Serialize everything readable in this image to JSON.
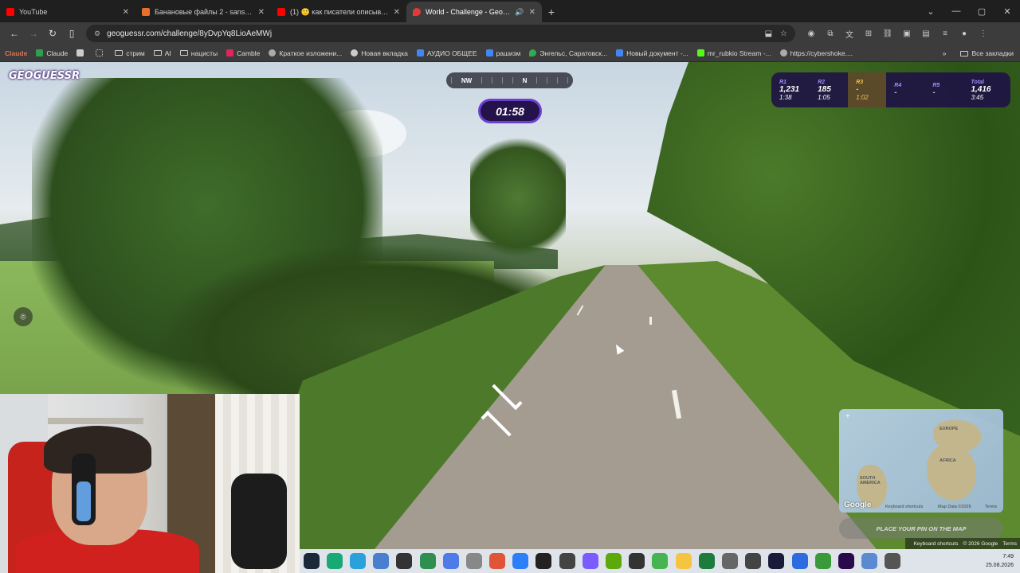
{
  "tabs": [
    {
      "title": "YouTube",
      "favicon_color": "#ff0000",
      "active": false
    },
    {
      "title": "Банановые файлы 2 - sansgot...",
      "favicon_color": "#e8702a",
      "active": false
    },
    {
      "title": "(1) 🙂 как писатели описывают...",
      "favicon_color": "#ff0000",
      "active": false
    },
    {
      "title": "World - Challenge - GeoGu...",
      "favicon_color": "#e03a3a",
      "active": true
    }
  ],
  "address_bar": {
    "url": "geoguessr.com/challenge/8yDvpYq8LioAeMWj"
  },
  "bookmarks": [
    {
      "label": "Claude",
      "icon": "claude-icon",
      "color": "#d97757"
    },
    {
      "label": "Claude",
      "icon": "claude-icon",
      "color": "#2e9e4f"
    },
    {
      "label": "",
      "icon": "page-icon",
      "color": "#cccccc"
    },
    {
      "label": "",
      "icon": "apps-icon",
      "color": "#cccccc"
    },
    {
      "label": "стрим",
      "icon": "folder-icon",
      "color": ""
    },
    {
      "label": "AI",
      "icon": "folder-icon",
      "color": ""
    },
    {
      "label": "нацисты",
      "icon": "folder-icon",
      "color": ""
    },
    {
      "label": "Camble",
      "icon": "camble-icon",
      "color": "#e0245e"
    },
    {
      "label": "Краткое изложени...",
      "icon": "globe-icon",
      "color": "#aaaaaa"
    },
    {
      "label": "Новая вкладка",
      "icon": "pin-icon",
      "color": "#cccccc"
    },
    {
      "label": "АУДИО ОБЩЕЕ",
      "icon": "doc-icon",
      "color": "#4285f4"
    },
    {
      "label": "рашизм",
      "icon": "doc-icon",
      "color": "#4285f4"
    },
    {
      "label": "Энгельс, Саратовск...",
      "icon": "maps-icon",
      "color": "#34a853"
    },
    {
      "label": "Новый документ -...",
      "icon": "doc-icon",
      "color": "#4285f4"
    },
    {
      "label": "mr_rubkio Stream -...",
      "icon": "kick-icon",
      "color": "#53fc18"
    },
    {
      "label": "https://cybershoke....",
      "icon": "cybershoke-icon",
      "color": "#aaaaaa"
    }
  ],
  "bookmarks_all": "Все закладки",
  "game": {
    "logo": "GEOGUESSR",
    "compass": {
      "left": "NW",
      "center": "N"
    },
    "timer": "01:58",
    "rounds": [
      {
        "label": "R1",
        "points": "1,231",
        "time": "1:38"
      },
      {
        "label": "R2",
        "points": "185",
        "time": "1:05"
      },
      {
        "label": "R3",
        "points": "-",
        "time": "1:02"
      },
      {
        "label": "R4",
        "points": "-",
        "time": ""
      },
      {
        "label": "R5",
        "points": "-",
        "time": ""
      },
      {
        "label": "Total",
        "points": "1,416",
        "time": "3:45"
      }
    ],
    "map": {
      "labels": [
        "EUROPE",
        "AFRICA",
        "SOUTH AMERICA"
      ],
      "google": "Google",
      "keyboard": "Keyboard shortcuts",
      "mapdata": "Map Data ©2026",
      "terms": "Terms"
    },
    "place_pin": "PLACE YOUR PIN ON THE MAP",
    "footer": {
      "keyboard": "Keyboard shortcuts",
      "copyright": "© 2026 Google",
      "terms": "Terms"
    }
  },
  "taskbar": {
    "icons": [
      {
        "name": "steam-icon",
        "color": "#1b2838"
      },
      {
        "name": "app-icon",
        "color": "#19a974"
      },
      {
        "name": "telegram-icon",
        "color": "#2aa1da"
      },
      {
        "name": "app-icon",
        "color": "#4a7fd0"
      },
      {
        "name": "terminal-icon",
        "color": "#333333"
      },
      {
        "name": "app-icon",
        "color": "#2f8f4e"
      },
      {
        "name": "app-icon",
        "color": "#4f7be8"
      },
      {
        "name": "app-icon",
        "color": "#888888"
      },
      {
        "name": "app-icon",
        "color": "#e0553a"
      },
      {
        "name": "app-icon",
        "color": "#2d7ff9"
      },
      {
        "name": "app-icon",
        "color": "#222222"
      },
      {
        "name": "openai-icon",
        "color": "#444444"
      },
      {
        "name": "app-icon",
        "color": "#7b5cff"
      },
      {
        "name": "nvidia-icon",
        "color": "#5da80b"
      },
      {
        "name": "app-icon",
        "color": "#333333"
      },
      {
        "name": "app-icon",
        "color": "#46b450"
      },
      {
        "name": "app-icon",
        "color": "#f5c542"
      },
      {
        "name": "app-icon",
        "color": "#1c7c3c"
      },
      {
        "name": "app-icon",
        "color": "#666666"
      },
      {
        "name": "app-icon",
        "color": "#444444"
      },
      {
        "name": "app-icon",
        "color": "#1a1a3a"
      },
      {
        "name": "app-icon",
        "color": "#2d6cdf"
      },
      {
        "name": "app-icon",
        "color": "#3a9a3a"
      },
      {
        "name": "premiere-icon",
        "color": "#2a0a4a"
      },
      {
        "name": "app-icon",
        "color": "#5a8ad0"
      },
      {
        "name": "settings-icon",
        "color": "#555555"
      }
    ],
    "time": "7:49",
    "date": "25.08.2026"
  }
}
